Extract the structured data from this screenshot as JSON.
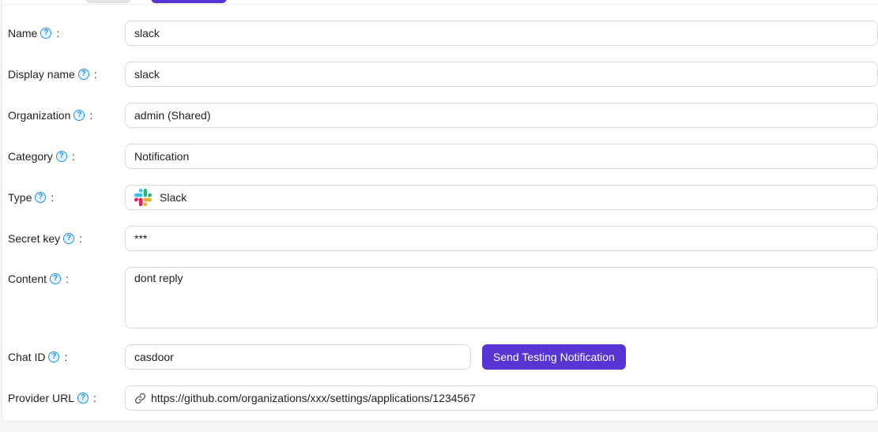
{
  "page": {
    "background": "#f6f6f6",
    "card_background": "#ffffff",
    "card_border": "#ebebeb",
    "divider_color": "#eeeeee"
  },
  "header_partial_buttons": {
    "secondary_color": "#e3e3e3",
    "primary_color": "#5734d3"
  },
  "theme": {
    "accent": "#5734d3",
    "help_icon_color": "#1890ff",
    "input_border": "#d9d9d9",
    "slack_colors": [
      "#36C5F0",
      "#2EB67D",
      "#ECB22E",
      "#E01E5A"
    ]
  },
  "form": {
    "colon": ":",
    "help_symbol": "?",
    "rows": [
      {
        "label": "Name",
        "value": "slack"
      },
      {
        "label": "Display name",
        "value": "slack"
      },
      {
        "label": "Organization",
        "value": "admin (Shared)"
      },
      {
        "label": "Category",
        "value": "Notification"
      },
      {
        "label": "Type",
        "value": "Slack",
        "icon": "slack-logo"
      },
      {
        "label": "Secret key",
        "value": "***"
      },
      {
        "label": "Content",
        "value": "dont reply"
      },
      {
        "label": "Chat ID",
        "value": "casdoor",
        "button_label": "Send Testing Notification"
      },
      {
        "label": "Provider URL",
        "value": "https://github.com/organizations/xxx/settings/applications/1234567",
        "icon": "link"
      }
    ]
  }
}
